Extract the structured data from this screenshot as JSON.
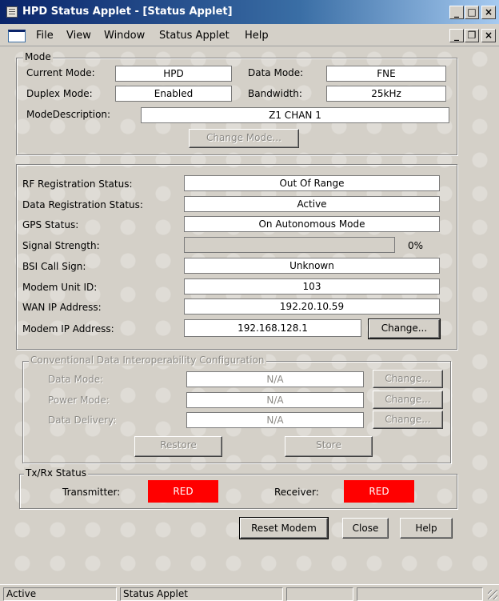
{
  "window": {
    "title": "HPD Status Applet - [Status Applet]",
    "caption_buttons": {
      "minimize": "_",
      "maximize": "□",
      "close": "×"
    }
  },
  "menu": {
    "items": [
      {
        "label": "File"
      },
      {
        "label": "View"
      },
      {
        "label": "Window"
      },
      {
        "label": "Status Applet"
      },
      {
        "label": "Help"
      }
    ],
    "mdi_buttons": {
      "minimize": "_",
      "restore": "❐",
      "close": "×"
    }
  },
  "mode": {
    "legend": "Mode",
    "current_mode_label": "Current Mode:",
    "current_mode_value": "HPD",
    "data_mode_label": "Data Mode:",
    "data_mode_value": "FNE",
    "duplex_mode_label": "Duplex Mode:",
    "duplex_mode_value": "Enabled",
    "bandwidth_label": "Bandwidth:",
    "bandwidth_value": "25kHz",
    "mode_description_label": "ModeDescription:",
    "mode_description_value": "Z1  CHAN 1",
    "change_mode_button": "Change Mode..."
  },
  "status": {
    "rf_label": "RF Registration Status:",
    "rf_value": "Out Of Range",
    "data_reg_label": "Data Registration Status:",
    "data_reg_value": "Active",
    "gps_label": "GPS Status:",
    "gps_value": "On Autonomous Mode",
    "signal_label": "Signal Strength:",
    "signal_percent_text": "0%",
    "signal_level": 0,
    "bsi_label": "BSI Call Sign:",
    "bsi_value": "Unknown",
    "unit_id_label": "Modem Unit ID:",
    "unit_id_value": "103",
    "wan_label": "WAN IP Address:",
    "wan_value": "192.20.10.59",
    "modem_ip_label": "Modem IP Address:",
    "modem_ip_value": "192.168.128.1",
    "change_button": "Change..."
  },
  "conventional": {
    "legend": "Conventional Data Interoperability Configuration",
    "data_mode_label": "Data Mode:",
    "data_mode_value": "N/A",
    "power_mode_label": "Power Mode:",
    "power_mode_value": "N/A",
    "data_delivery_label": "Data Delivery:",
    "data_delivery_value": "N/A",
    "change_label": "Change...",
    "restore_button": "Restore",
    "store_button": "Store"
  },
  "txrx": {
    "legend": "Tx/Rx Status",
    "transmitter_label": "Transmitter:",
    "transmitter_value": "RED",
    "receiver_label": "Receiver:",
    "receiver_value": "RED",
    "indicator_color": "#ff0000"
  },
  "actions": {
    "reset_modem": "Reset Modem",
    "close": "Close",
    "help": "Help"
  },
  "statusbar": {
    "panel1": "Active",
    "panel2": "Status Applet"
  }
}
